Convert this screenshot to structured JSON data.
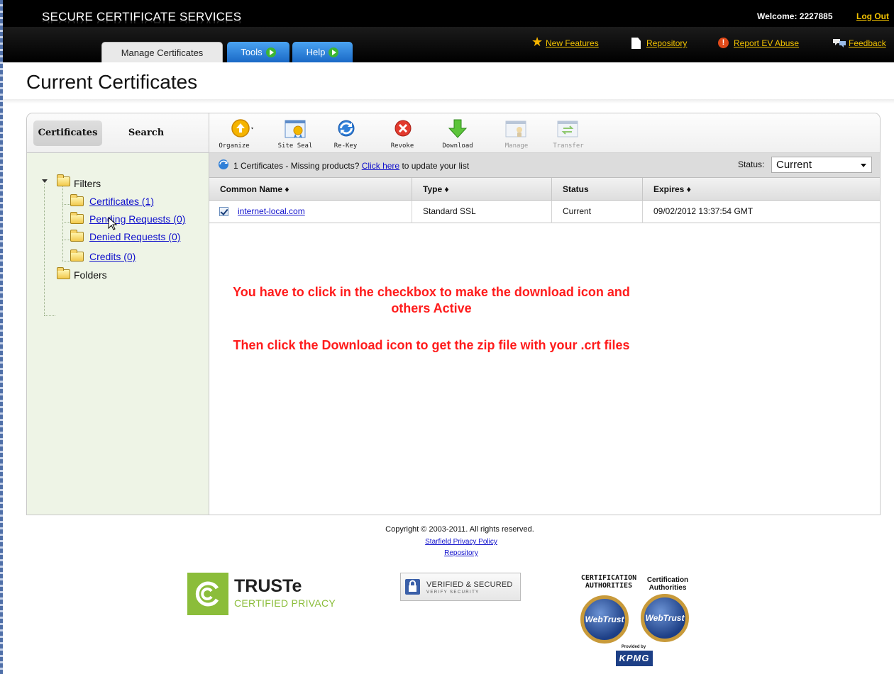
{
  "header": {
    "brand": "SECURE CERTIFICATE SERVICES",
    "welcome": "Welcome: 2227885",
    "logout": "Log Out",
    "tabs": [
      {
        "label": "Manage Certificates"
      },
      {
        "label": "Tools"
      },
      {
        "label": "Help"
      }
    ],
    "links": {
      "new_features": "New Features",
      "repository": "Repository",
      "report_ev": "Report EV Abuse",
      "feedback": "Feedback"
    }
  },
  "page_title": "Current Certificates",
  "sidebar": {
    "tabs": {
      "certificates": "Certificates",
      "search": "Search"
    },
    "tree": {
      "filters": "Filters",
      "items": [
        {
          "label": "Certificates (1)"
        },
        {
          "label": "Pending Requests (0)"
        },
        {
          "label": "Denied Requests (0)"
        },
        {
          "label": "Credits (0)"
        }
      ],
      "folders": "Folders"
    }
  },
  "toolbar": {
    "buttons": [
      {
        "label": "Organize",
        "icon": "organize-icon",
        "enabled": true
      },
      {
        "label": "Site Seal",
        "icon": "site-seal-icon",
        "enabled": true
      },
      {
        "label": "Re-Key",
        "icon": "rekey-icon",
        "enabled": true
      },
      {
        "label": "Revoke",
        "icon": "revoke-icon",
        "enabled": true
      },
      {
        "label": "Download",
        "icon": "download-icon",
        "enabled": true
      },
      {
        "label": "Manage",
        "icon": "manage-icon",
        "enabled": false
      },
      {
        "label": "Transfer",
        "icon": "transfer-icon",
        "enabled": false
      }
    ]
  },
  "status_bar": {
    "count_text": "1 Certificates - Missing products?",
    "link_text": "Click here",
    "suffix": "to update your list",
    "status_label": "Status:",
    "status_value": "Current"
  },
  "table": {
    "columns": [
      "Common Name ♦",
      "Type ♦",
      "Status",
      "Expires ♦"
    ],
    "rows": [
      {
        "checked": true,
        "common_name": "internet-local.com",
        "type": "Standard SSL",
        "status": "Current",
        "expires": "09/02/2012 13:37:54 GMT"
      }
    ]
  },
  "annotations": {
    "line1": "You have to click in the checkbox to make the download icon and others Active",
    "line2": "Then click the Download icon to get the zip file with your .crt files"
  },
  "footer": {
    "copyright": "Copyright © 2003-2011. All rights reserved.",
    "privacy": "Starfield Privacy Policy",
    "repository": "Repository",
    "truste_name": "TRUSTe",
    "truste_sub": "CERTIFIED PRIVACY",
    "verified": "VERIFIED & SECURED",
    "verified_sub": "VERIFY SECURITY",
    "ca1": "CERTIFICATION AUTHORITIES",
    "ca2": "Certification Authorities",
    "webtrust": "WebTrust",
    "provided_by": "Provided by",
    "kpmg": "KPMG"
  },
  "colors": {
    "accent_link": "#1010cc",
    "annotation_red": "#ff1b1b",
    "header_link": "#f2c200",
    "sidebar_bg": "#eef4e6"
  }
}
